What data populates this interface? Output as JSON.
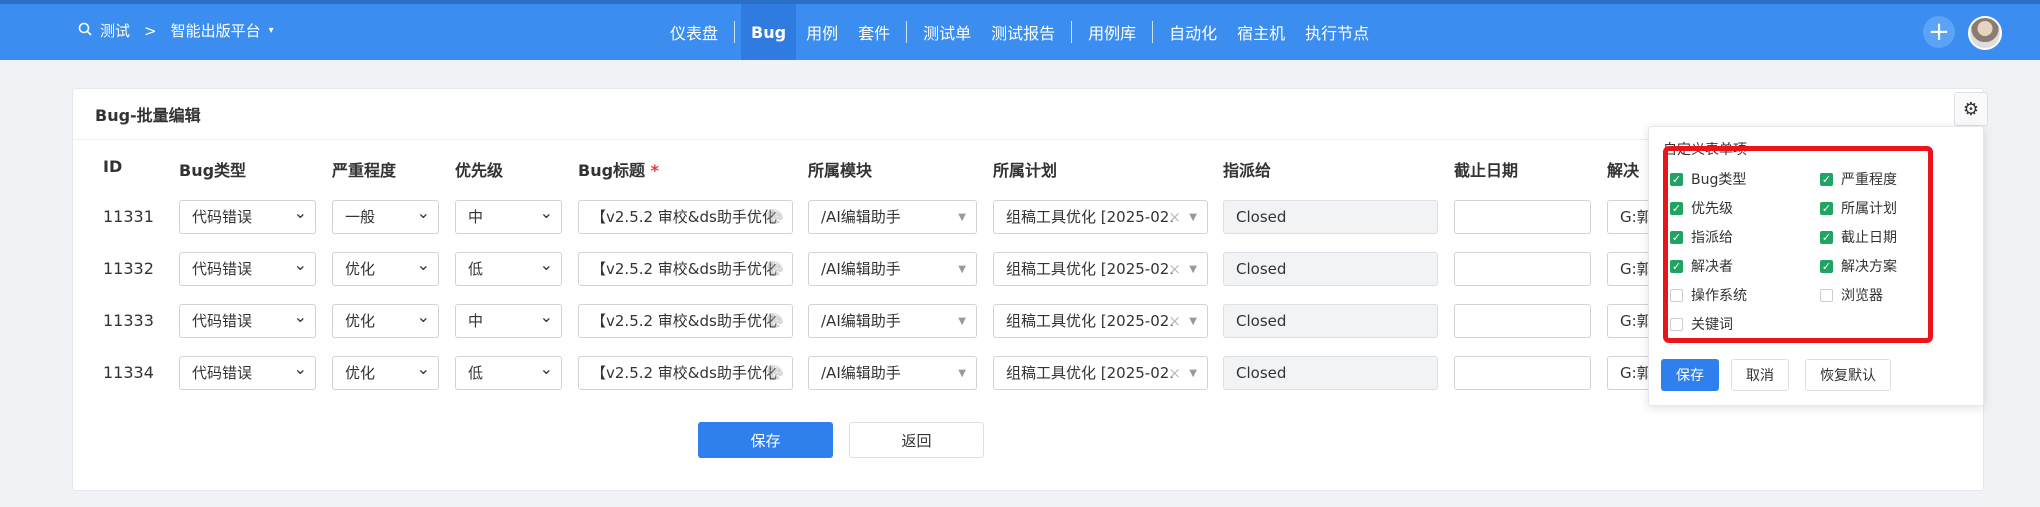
{
  "nav": {
    "project": "测试",
    "product": "智能出版平台",
    "items": [
      {
        "label": "仪表盘",
        "active": false
      },
      {
        "label": "Bug",
        "active": true
      },
      {
        "label": "用例",
        "active": false
      },
      {
        "label": "套件",
        "active": false
      },
      {
        "label": "测试单",
        "active": false
      },
      {
        "label": "测试报告",
        "active": false
      },
      {
        "label": "用例库",
        "active": false
      },
      {
        "label": "自动化",
        "active": false
      },
      {
        "label": "宿主机",
        "active": false
      },
      {
        "label": "执行节点",
        "active": false
      }
    ],
    "add_label": "+"
  },
  "card": {
    "title": "Bug-批量编辑"
  },
  "table": {
    "headers": {
      "id": "ID",
      "type": "Bug类型",
      "severity": "严重程度",
      "priority": "优先级",
      "title": "Bug标题",
      "required_mark": "*",
      "module": "所属模块",
      "plan": "所属计划",
      "assigned": "指派给",
      "deadline": "截止日期",
      "resolve": "解决"
    },
    "rows": [
      {
        "id": "11331",
        "type": "代码错误",
        "severity": "一般",
        "priority": "中",
        "title": "【v2.5.2 审校&ds助手优化",
        "module": "/AI编辑助手",
        "plan": "组稿工具优化 [2025-02.",
        "assigned": "Closed",
        "deadline": "",
        "resolve": "G:郭"
      },
      {
        "id": "11332",
        "type": "代码错误",
        "severity": "优化",
        "priority": "低",
        "title": "【v2.5.2 审校&ds助手优化",
        "module": "/AI编辑助手",
        "plan": "组稿工具优化 [2025-02.",
        "assigned": "Closed",
        "deadline": "",
        "resolve": "G:郭"
      },
      {
        "id": "11333",
        "type": "代码错误",
        "severity": "优化",
        "priority": "中",
        "title": "【v2.5.2 审校&ds助手优化",
        "module": "/AI编辑助手",
        "plan": "组稿工具优化 [2025-02.",
        "assigned": "Closed",
        "deadline": "",
        "resolve": "G:郭"
      },
      {
        "id": "11334",
        "type": "代码错误",
        "severity": "优化",
        "priority": "低",
        "title": "【v2.5.2 审校&ds助手优化",
        "module": "/AI编辑助手",
        "plan": "组稿工具优化 [2025-02.",
        "assigned": "Closed",
        "deadline": "",
        "resolve": "G:郭"
      }
    ]
  },
  "actions": {
    "save": "保存",
    "back": "返回"
  },
  "popover": {
    "title": "自定义表单项",
    "fields": [
      {
        "label": "Bug类型",
        "checked": true
      },
      {
        "label": "严重程度",
        "checked": true
      },
      {
        "label": "优先级",
        "checked": true
      },
      {
        "label": "所属计划",
        "checked": true
      },
      {
        "label": "指派给",
        "checked": true
      },
      {
        "label": "截止日期",
        "checked": true
      },
      {
        "label": "解决者",
        "checked": true
      },
      {
        "label": "解决方案",
        "checked": true
      },
      {
        "label": "操作系统",
        "checked": false
      },
      {
        "label": "浏览器",
        "checked": false
      },
      {
        "label": "关键词",
        "checked": false
      }
    ],
    "save": "保存",
    "cancel": "取消",
    "reset": "恢复默认"
  },
  "colors": {
    "primary": "#3b8df0",
    "checkbox_on": "#1fa463",
    "highlight": "#e8151b"
  }
}
